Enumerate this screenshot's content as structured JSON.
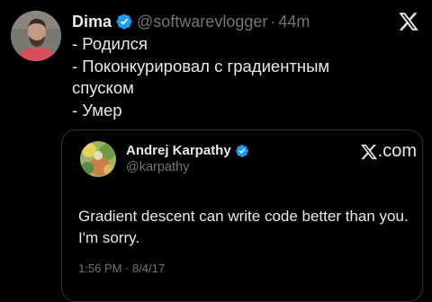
{
  "tweet": {
    "author_name": "Dima",
    "author_handle": "@softwarevlogger",
    "separator": "·",
    "time": "44m",
    "lines": [
      "- Родился",
      "- Поконкурировал с градиентным",
      "спуском",
      "- Умер"
    ]
  },
  "quote": {
    "author_name": "Andrej Karpathy",
    "author_handle": "@karpathy",
    "brand": ".com",
    "lines": [
      "Gradient descent can write code better than you.",
      "I'm sorry."
    ],
    "timestamp": "1:56 PM · 8/4/17"
  },
  "icons": {
    "verified": "verified-badge-icon",
    "brand_logo": "x-logo-icon"
  },
  "colors": {
    "background": "#000000",
    "text": "#e7e9ea",
    "muted": "#71767b",
    "verified": "#1d9bf0",
    "border": "#2f3336"
  }
}
